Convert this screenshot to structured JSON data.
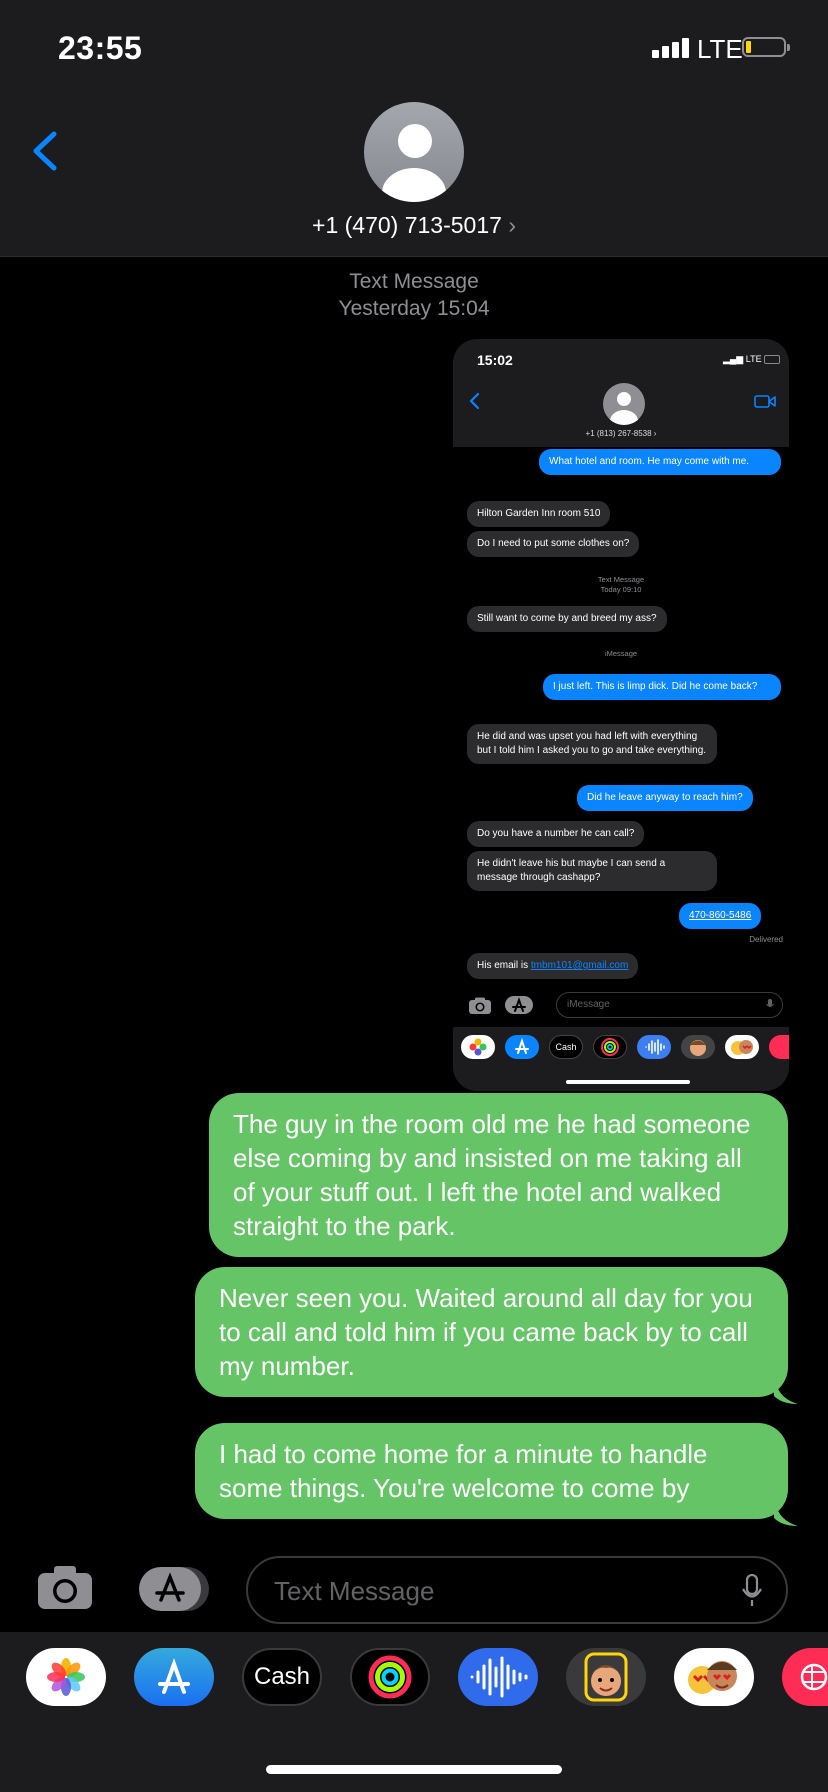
{
  "status_bar": {
    "time": "23:55",
    "network": "LTE"
  },
  "header": {
    "contact": "+1 (470) 713-5017",
    "chevron": "›"
  },
  "timestamp": {
    "kind": "Text Message",
    "when": "Yesterday 15:04"
  },
  "screenshot": {
    "time": "15:02",
    "network": "LTE",
    "contact": "+1 (813) 267-8538",
    "messages": [
      {
        "dir": "out",
        "text": "What hotel and room. He may come with me."
      },
      {
        "dir": "in",
        "text": "Hilton Garden Inn room 510"
      },
      {
        "dir": "in",
        "text": "Do I need to put some clothes on?"
      },
      {
        "dir": "in",
        "text": "Still want to come by and breed my ass?"
      },
      {
        "dir": "out",
        "text": "I just left. This is limp dick. Did he come back?"
      },
      {
        "dir": "in",
        "text": "He did and was upset you had left with everything but I told him I asked you to go and take everything."
      },
      {
        "dir": "out",
        "text": "Did he leave anyway to reach him?"
      },
      {
        "dir": "in",
        "text": "Do you have a number he can call?"
      },
      {
        "dir": "in",
        "text": "He didn't leave his but maybe I can send a message through cashapp?"
      },
      {
        "dir": "out",
        "text": "470-860-5486"
      },
      {
        "dir": "in",
        "text": "His email is ",
        "link": "tmbm101@gmail.com"
      }
    ],
    "label_text_message": "Text Message",
    "label_today": "Today 09:10",
    "label_imessage": "iMessage",
    "delivered": "Delivered",
    "input_placeholder": "iMessage",
    "cash_label": "Cash"
  },
  "messages": [
    {
      "dir": "out",
      "text": "The guy in the room old me he had someone else coming by and insisted on me taking all of your stuff out. I left the hotel and walked straight to the park."
    },
    {
      "dir": "out",
      "text": "Never seen you. Waited around all day for you to call and told him if you came back by to call my number."
    },
    {
      "dir": "out",
      "text": "I had to come home for a minute to handle some things. You're welcome to come by"
    }
  ],
  "composer": {
    "placeholder": "Text Message"
  },
  "app_drawer": {
    "apps": [
      "photos-icon",
      "app-store-icon",
      "apple-cash-icon",
      "activity-icon",
      "audio-message-icon",
      "memoji-icon",
      "animoji-stickers-icon",
      "digital-touch-icon"
    ],
    "cash_label": "Cash"
  },
  "colors": {
    "accent": "#0a84ff",
    "sms_bubble": "#65c466",
    "incoming_bubble": "#2c2c2e",
    "background": "#000000"
  }
}
